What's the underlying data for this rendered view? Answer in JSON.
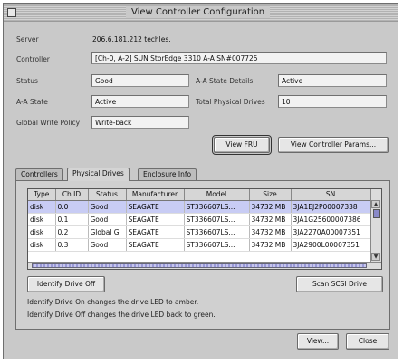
{
  "window": {
    "title": "View Controller Configuration"
  },
  "details": {
    "server_label": "Server",
    "server_value": "206.6.181.212 techles.",
    "controller_label": "Controller",
    "controller_value": "[Ch-0,  A-2] SUN StorEdge 3310 A-A SN#007725",
    "status_label": "Status",
    "status_value": "Good",
    "aa_state_details_label": "A-A State Details",
    "aa_state_details_value": "Active",
    "aa_state_label": "A-A State",
    "aa_state_value": "Active",
    "total_physical_drives_label": "Total Physical Drives",
    "total_physical_drives_value": "10",
    "global_write_policy_label": "Global Write Policy",
    "global_write_policy_value": "Write-back"
  },
  "buttons": {
    "view_fru": "View FRU",
    "view_controller_params": "View Controller Params...",
    "identify_drive": "Identify Drive Off",
    "scan_scsi_drive": "Scan SCSI Drive",
    "view": "View...",
    "close": "Close"
  },
  "tabs": [
    {
      "label": "Controllers"
    },
    {
      "label": "Physical Drives"
    },
    {
      "label": "Enclosure Info"
    }
  ],
  "drives_table": {
    "columns": [
      "Type",
      "Ch.ID",
      "Status",
      "Manufacturer",
      "Model",
      "Size",
      "SN"
    ],
    "rows": [
      [
        "disk",
        "0.0",
        "Good",
        "SEAGATE",
        "ST336607LS...",
        "34732 MB",
        "3JA1EJ2P00007338"
      ],
      [
        "disk",
        "0.1",
        "Good",
        "SEAGATE",
        "ST336607LS...",
        "34732 MB",
        "3JA1G25600007386"
      ],
      [
        "disk",
        "0.2",
        "Global G",
        "SEAGATE",
        "ST336607LS...",
        "34732 MB",
        "3JA2270A00007351"
      ],
      [
        "disk",
        "0.3",
        "Good",
        "SEAGATE",
        "ST336607LS...",
        "34732 MB",
        "3JA2900L00007351"
      ]
    ]
  },
  "info_text": {
    "line1": "Identify Drive On changes the drive LED to amber.",
    "line2": "Identify Drive Off changes the drive LED back to green."
  }
}
